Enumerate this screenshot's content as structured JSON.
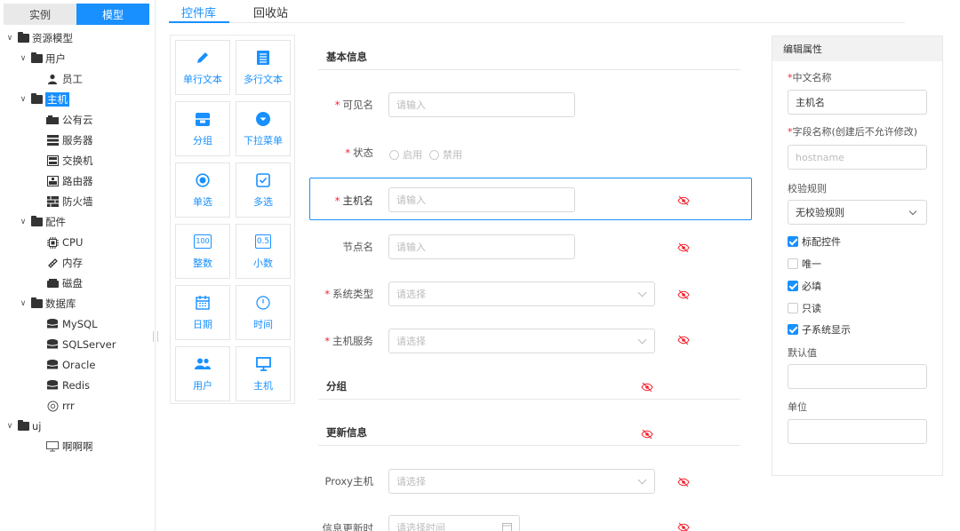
{
  "left_panel": {
    "tabs": [
      "实例",
      "模型"
    ],
    "tree": [
      {
        "label": "资源模型",
        "icon": "folder-icon"
      },
      {
        "label": "用户",
        "icon": "folder-icon"
      },
      {
        "label": "员工",
        "icon": "person-icon"
      },
      {
        "label": "主机",
        "icon": "folder-icon"
      },
      {
        "label": "公有云",
        "icon": "cloud-icon"
      },
      {
        "label": "服务器",
        "icon": "server-icon"
      },
      {
        "label": "交换机",
        "icon": "switch-icon"
      },
      {
        "label": "路由器",
        "icon": "router-icon"
      },
      {
        "label": "防火墙",
        "icon": "firewall-icon"
      },
      {
        "label": "配件",
        "icon": "folder-icon"
      },
      {
        "label": "CPU",
        "icon": "cpu-icon"
      },
      {
        "label": "内存",
        "icon": "memory-icon"
      },
      {
        "label": "磁盘",
        "icon": "disk-icon"
      },
      {
        "label": "数据库",
        "icon": "folder-icon"
      },
      {
        "label": "MySQL",
        "icon": "database-icon"
      },
      {
        "label": "SQLServer",
        "icon": "database-icon"
      },
      {
        "label": "Oracle",
        "icon": "database-icon"
      },
      {
        "label": "Redis",
        "icon": "database-icon"
      },
      {
        "label": "rrr",
        "icon": "gear-icon"
      },
      {
        "label": "uj",
        "icon": "folder-icon"
      },
      {
        "label": "啊啊啊",
        "icon": "monitor-icon"
      }
    ]
  },
  "tabs": [
    "控件库",
    "回收站"
  ],
  "palette": [
    {
      "label": "单行文本",
      "icon": "pencil-icon"
    },
    {
      "label": "多行文本",
      "icon": "multiline-icon"
    },
    {
      "label": "分组",
      "icon": "group-icon"
    },
    {
      "label": "下拉菜单",
      "icon": "dropdown-icon"
    },
    {
      "label": "单选",
      "icon": "radio-icon"
    },
    {
      "label": "多选",
      "icon": "checkbox-icon"
    },
    {
      "label": "整数",
      "icon": "integer-icon",
      "glyph": "100"
    },
    {
      "label": "小数",
      "icon": "decimal-icon",
      "glyph": "0.5"
    },
    {
      "label": "日期",
      "icon": "calendar-icon"
    },
    {
      "label": "时间",
      "icon": "clock-icon"
    },
    {
      "label": "用户",
      "icon": "users-icon"
    },
    {
      "label": "主机",
      "icon": "monitor-icon"
    }
  ],
  "form": {
    "section_basic": "基本信息",
    "visible_name": {
      "label": "可见名",
      "placeholder": "请输入"
    },
    "status": {
      "label": "状态",
      "options": [
        "启用",
        "禁用"
      ]
    },
    "hostname": {
      "label": "主机名",
      "placeholder": "请输入"
    },
    "node_name": {
      "label": "节点名",
      "placeholder": "请输入"
    },
    "system_type": {
      "label": "系统类型",
      "placeholder": "请选择"
    },
    "host_service": {
      "label": "主机服务",
      "placeholder": "请选择"
    },
    "section_group": "分组",
    "section_update": "更新信息",
    "proxy_host": {
      "label": "Proxy主机",
      "placeholder": "请选择"
    },
    "info_update_time": {
      "label": "信息更新时",
      "placeholder": "请选择时间"
    }
  },
  "props": {
    "title": "编辑属性",
    "cn_name_label": "中文名称",
    "cn_name_value": "主机名",
    "field_name_label": "字段名称(创建后不允许修改)",
    "field_name_placeholder": "hostname",
    "validation_label": "校验规则",
    "validation_value": "无校验规则",
    "checks": [
      {
        "label": "标配控件",
        "checked": true
      },
      {
        "label": "唯一",
        "checked": false
      },
      {
        "label": "必填",
        "checked": true
      },
      {
        "label": "只读",
        "checked": false
      },
      {
        "label": "子系统显示",
        "checked": true
      }
    ],
    "default_label": "默认值",
    "unit_label": "单位"
  },
  "colors": {
    "accent": "#1890ff",
    "required": "#f5222d",
    "hidden_eye": "#f5222d"
  }
}
